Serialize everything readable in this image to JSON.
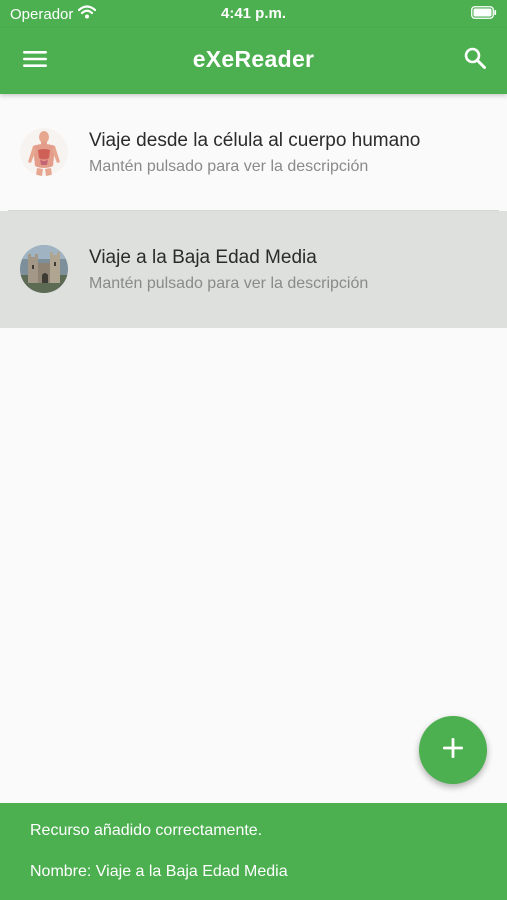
{
  "status_bar": {
    "carrier": "Operador",
    "time": "4:41 p.m.",
    "wifi_icon": "wifi-icon",
    "battery_icon": "battery-icon"
  },
  "app_bar": {
    "title": "eXeReader",
    "menu_icon": "menu-icon",
    "search_icon": "search-icon"
  },
  "resources": [
    {
      "title": "Viaje desde la célula al cuerpo humano",
      "subtitle": "Mantén pulsado para ver la descripción",
      "thumbnail": "human-anatomy-thumbnail",
      "selected": false
    },
    {
      "title": "Viaje a la Baja Edad Media",
      "subtitle": "Mantén pulsado para ver la descripción",
      "thumbnail": "medieval-castle-thumbnail",
      "selected": true
    }
  ],
  "fab": {
    "icon": "plus-icon"
  },
  "snackbar": {
    "message": "Recurso añadido correctamente.",
    "detail": "Nombre: Viaje a la Baja Edad Media"
  },
  "colors": {
    "primary": "#4caf50",
    "selected_row": "#dde0dc",
    "background": "#fafafa",
    "subtitle_text": "#8a8a8a"
  }
}
